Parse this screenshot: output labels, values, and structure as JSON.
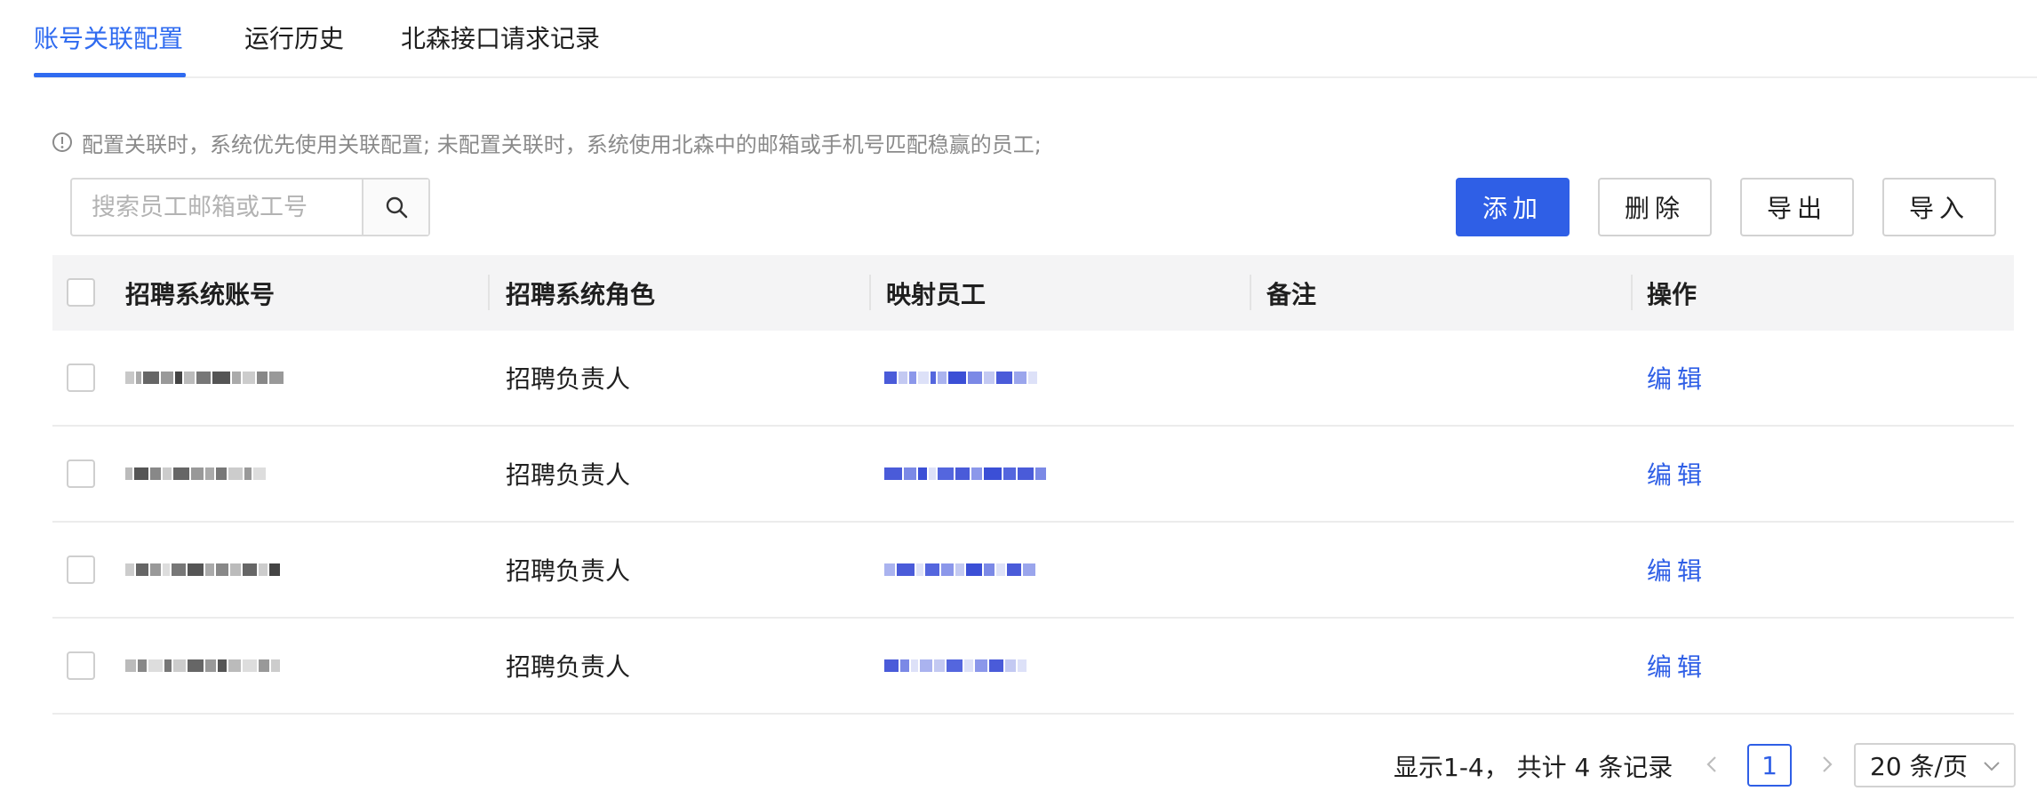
{
  "tabs": [
    {
      "label": "账号关联配置",
      "active": true
    },
    {
      "label": "运行历史",
      "active": false
    },
    {
      "label": "北森接口请求记录",
      "active": false
    }
  ],
  "notice": {
    "icon": "info-circle-icon",
    "text": "配置关联时，系统优先使用关联配置; 未配置关联时，系统使用北森中的邮箱或手机号匹配稳赢的员工;"
  },
  "search": {
    "placeholder": "搜索员工邮箱或工号",
    "value": "",
    "icon": "search-icon"
  },
  "actions": {
    "add": "添加",
    "delete": "删除",
    "export": "导出",
    "import": "导入"
  },
  "table": {
    "columns": [
      "招聘系统账号",
      "招聘系统角色",
      "映射员工",
      "备注",
      "操作"
    ],
    "rows": [
      {
        "account": "[redacted]",
        "role": "招聘负责人",
        "employee": "[redacted]",
        "note": "",
        "action": "编辑"
      },
      {
        "account": "[redacted]",
        "role": "招聘负责人",
        "employee": "[redacted]",
        "note": "",
        "action": "编辑"
      },
      {
        "account": "[redacted]",
        "role": "招聘负责人",
        "employee": "[redacted]",
        "note": "",
        "action": "编辑"
      },
      {
        "account": "[redacted]",
        "role": "招聘负责人",
        "employee": "[redacted]",
        "note": "",
        "action": "编辑"
      }
    ]
  },
  "pagination": {
    "info": "显示1-4， 共计 4 条记录",
    "current_page": "1",
    "page_size": "20 条/页"
  },
  "colors": {
    "accent": "#2f6bf0",
    "primary_button": "#2f5fe6",
    "link": "#2f5fe6",
    "header_bg": "#f4f4f5"
  }
}
